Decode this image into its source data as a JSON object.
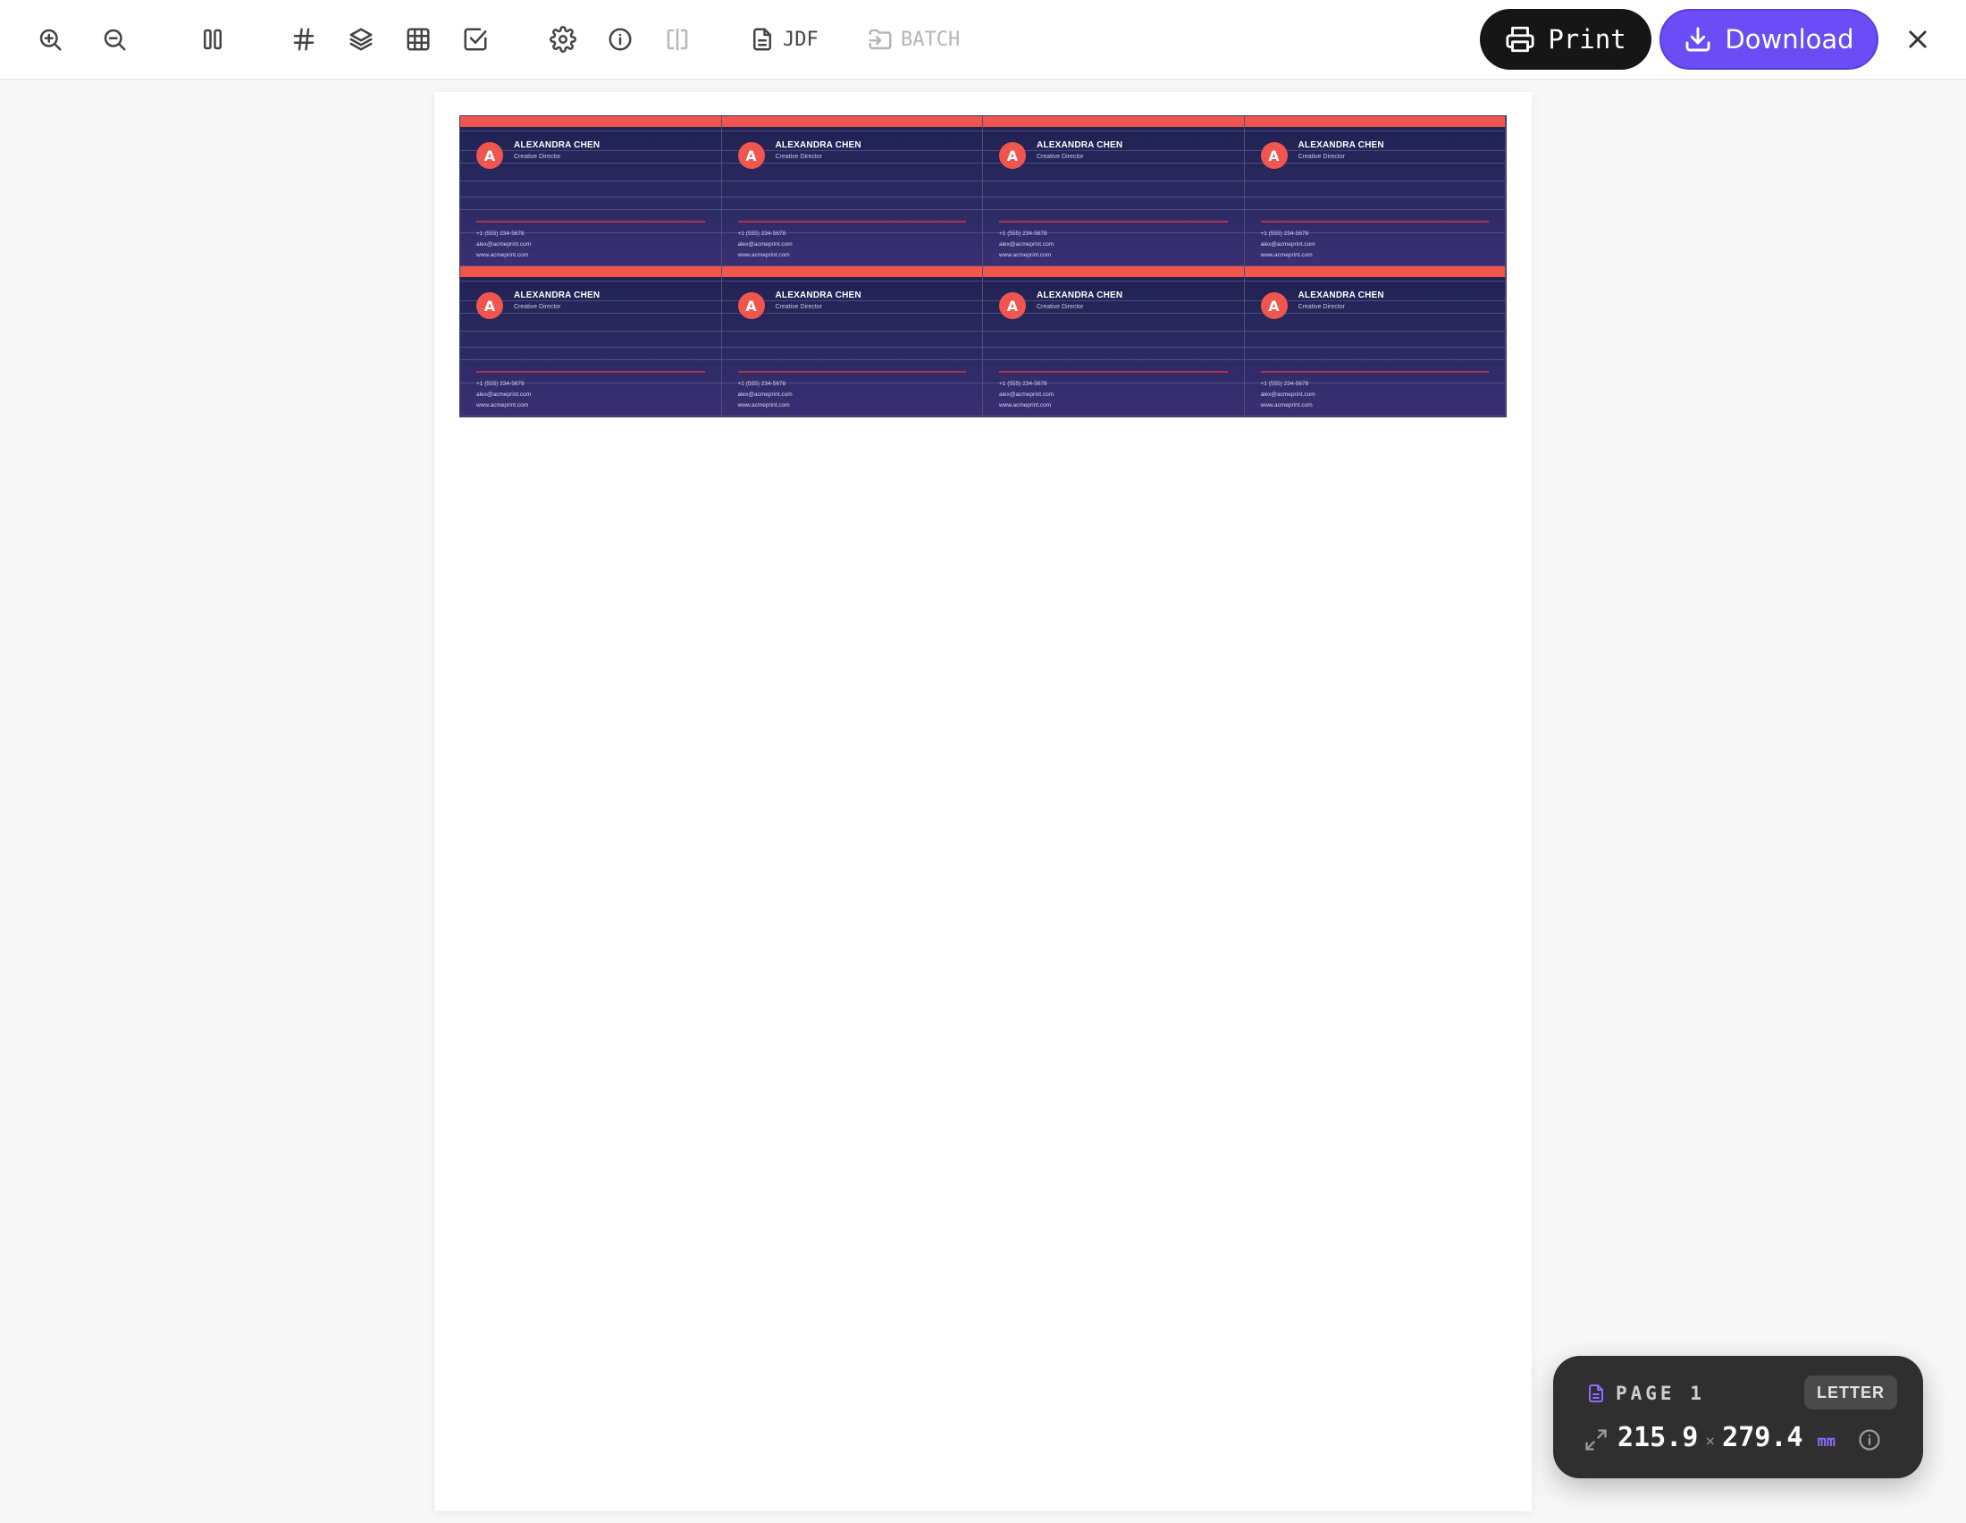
{
  "toolbar": {
    "jdf_label": "JDF",
    "batch_label": "BATCH",
    "print_label": "Print",
    "download_label": "Download"
  },
  "cards": [
    {
      "initial": "A",
      "name": "ALEXANDRA CHEN",
      "title": "Creative Director",
      "phone": "+1 (555) 234-5678",
      "email": "alex@acmeprint.com",
      "web": "www.acmeprint.com"
    },
    {
      "initial": "A",
      "name": "ALEXANDRA CHEN",
      "title": "Creative Director",
      "phone": "+1 (555) 234-5678",
      "email": "alex@acmeprint.com",
      "web": "www.acmeprint.com"
    },
    {
      "initial": "A",
      "name": "ALEXANDRA CHEN",
      "title": "Creative Director",
      "phone": "+1 (555) 234-5678",
      "email": "alex@acmeprint.com",
      "web": "www.acmeprint.com"
    },
    {
      "initial": "A",
      "name": "ALEXANDRA CHEN",
      "title": "Creative Director",
      "phone": "+1 (555) 234-5678",
      "email": "alex@acmeprint.com",
      "web": "www.acmeprint.com"
    },
    {
      "initial": "A",
      "name": "ALEXANDRA CHEN",
      "title": "Creative Director",
      "phone": "+1 (555) 234-5678",
      "email": "alex@acmeprint.com",
      "web": "www.acmeprint.com"
    },
    {
      "initial": "A",
      "name": "ALEXANDRA CHEN",
      "title": "Creative Director",
      "phone": "+1 (555) 234-5678",
      "email": "alex@acmeprint.com",
      "web": "www.acmeprint.com"
    },
    {
      "initial": "A",
      "name": "ALEXANDRA CHEN",
      "title": "Creative Director",
      "phone": "+1 (555) 234-5678",
      "email": "alex@acmeprint.com",
      "web": "www.acmeprint.com"
    },
    {
      "initial": "A",
      "name": "ALEXANDRA CHEN",
      "title": "Creative Director",
      "phone": "+1 (555) 234-5678",
      "email": "alex@acmeprint.com",
      "web": "www.acmeprint.com"
    }
  ],
  "info_panel": {
    "page_label": "PAGE 1",
    "paper_size": "LETTER",
    "width": "215.9",
    "times": "×",
    "height": "279.4",
    "unit": "mm"
  },
  "colors": {
    "accent": "#6b4df5",
    "card_stripe": "#f0554e",
    "card_bg": "#1f2150"
  }
}
